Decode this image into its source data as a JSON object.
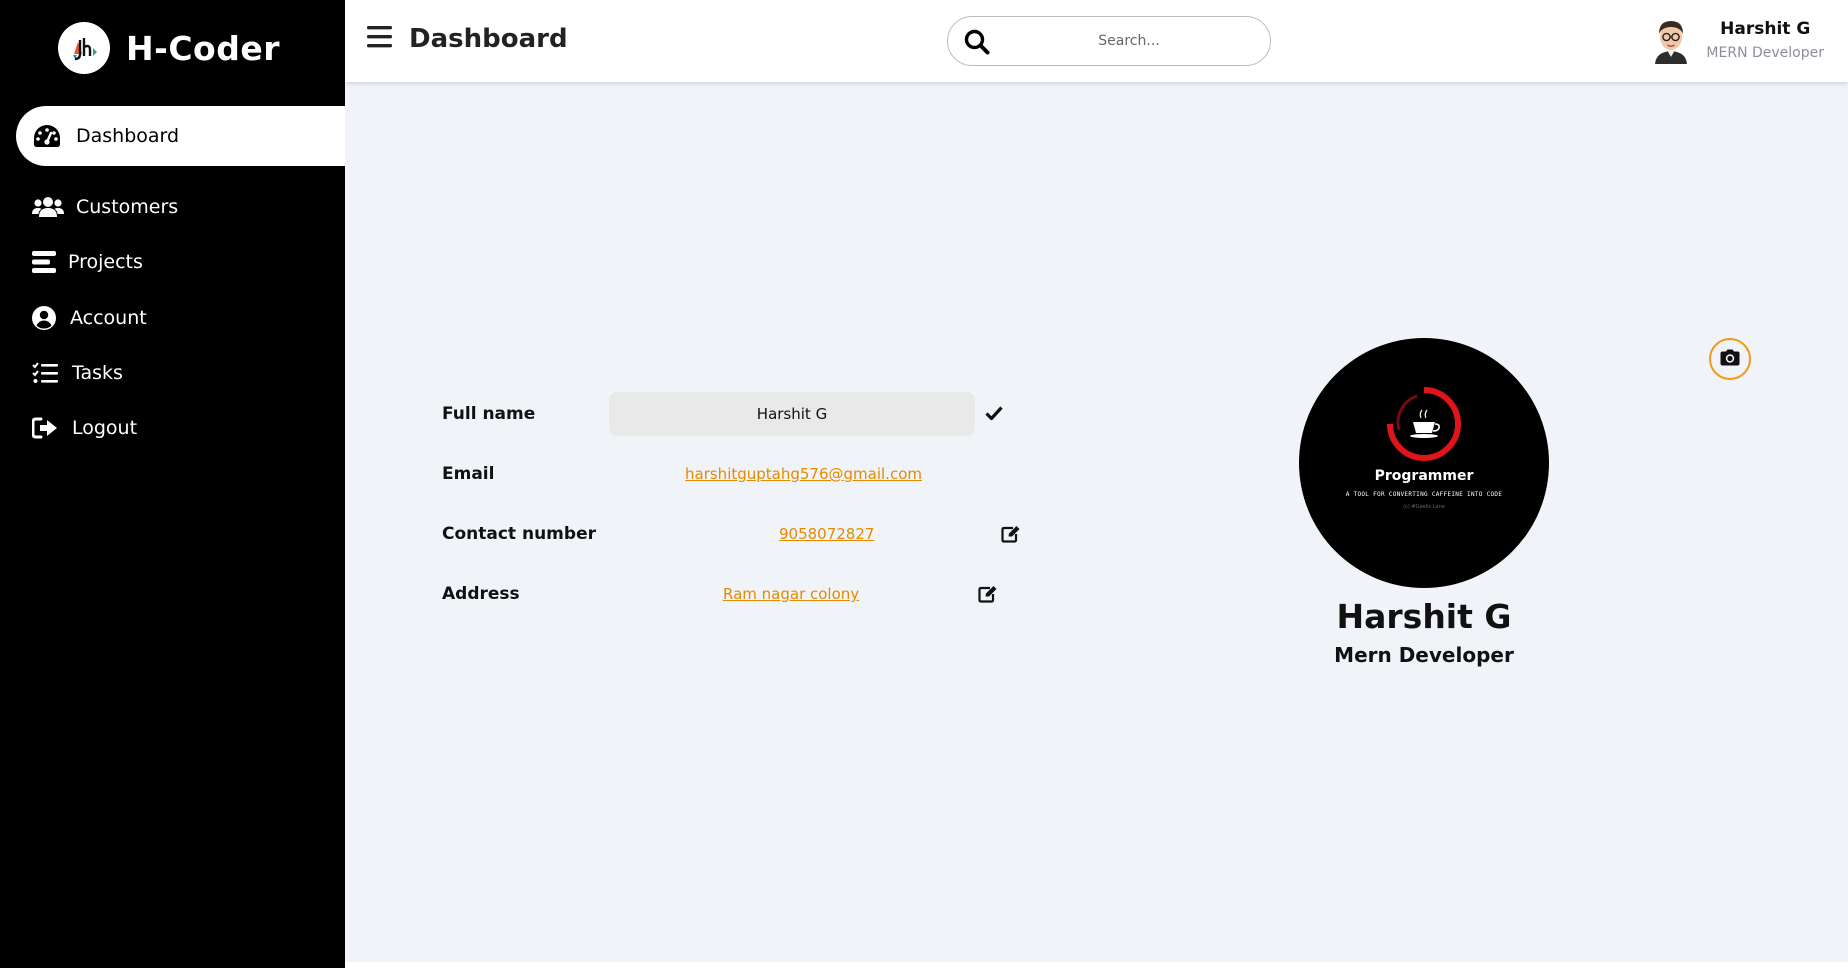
{
  "brand": {
    "name": "H-Coder",
    "logo_icon": "jh-logo-icon"
  },
  "sidebar": {
    "items": [
      {
        "label": "Dashboard",
        "icon": "gauge-icon",
        "active": true
      },
      {
        "label": "Customers",
        "icon": "users-icon",
        "active": false
      },
      {
        "label": "Projects",
        "icon": "bars-icon",
        "active": false
      },
      {
        "label": "Account",
        "icon": "user-circle-icon",
        "active": false
      },
      {
        "label": "Tasks",
        "icon": "tasks-icon",
        "active": false
      },
      {
        "label": "Logout",
        "icon": "logout-icon",
        "active": false
      }
    ]
  },
  "header": {
    "title": "Dashboard",
    "search": {
      "placeholder": "Search...",
      "value": ""
    },
    "user": {
      "name": "Harshit G",
      "role": "MERN Developer",
      "avatar_icon": "cartoon-avatar-icon"
    }
  },
  "profile_form": {
    "full_name": {
      "label": "Full name",
      "value": "Harshit G"
    },
    "email": {
      "label": "Email",
      "value": "harshitguptahg576@gmail.com"
    },
    "contact": {
      "label": "Contact number",
      "value": "9058072827"
    },
    "address": {
      "label": "Address",
      "value": "Ram nagar colony"
    }
  },
  "profile_card": {
    "name": "Harshit G",
    "role": "Mern Developer",
    "picture": {
      "title": "Programmer",
      "tagline": "A TOOL FOR CONVERTING CAFFEINE INTO CODE",
      "credit": "(c) #Geeks Lane"
    }
  },
  "colors": {
    "sidebar_bg": "#000000",
    "main_bg": "#f0f3f8",
    "accent": "#e58a00",
    "picture_ring": "#e0141c"
  }
}
